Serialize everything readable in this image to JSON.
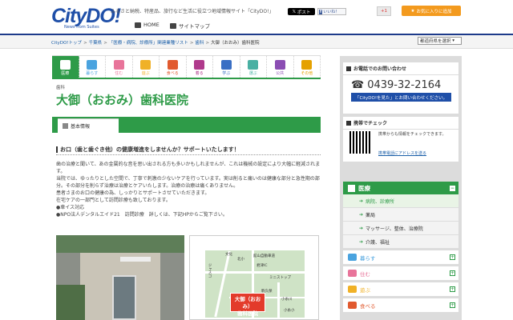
{
  "header": {
    "logo": "CityDO!",
    "logo_sub": "News from Suites",
    "tagline": "ふるさと納税、特産品、旅行など生活に役立つ地域情報サイト「CityDO!」",
    "nav_home": "HOME",
    "nav_sitemap": "サイトマップ",
    "x_button": "ポスト",
    "like_button": "いいね！",
    "gplus_button": "+1",
    "fav_button": "お気に入りに追加"
  },
  "breadcrumbs": [
    "CityDO!トップ",
    "千葉県",
    "「医療・病院、診療所」関連業種リスト",
    "歯科",
    "大御（おおみ）歯科医院"
  ],
  "prefecture_select": "都道府県を選択",
  "categories": [
    {
      "label": "医療",
      "color": "#2e9b48"
    },
    {
      "label": "暮らす",
      "color": "#4aa3df"
    },
    {
      "label": "住む",
      "color": "#e8749a"
    },
    {
      "label": "遊ぶ",
      "color": "#f0b127"
    },
    {
      "label": "食べる",
      "color": "#e15a2f"
    },
    {
      "label": "着る",
      "color": "#b03a8c"
    },
    {
      "label": "学ぶ",
      "color": "#3a6fc4"
    },
    {
      "label": "選ぶ",
      "color": "#49b0a3"
    },
    {
      "label": "公共",
      "color": "#8b4db3"
    },
    {
      "label": "その他",
      "color": "#e5a100"
    }
  ],
  "small_category": "歯科",
  "title": "大御（おおみ）歯科医院",
  "tab_basic": "基本情報",
  "section_heading": "お口（歯と歯ぐき他）の健康増進をしませんか？サポートいたします！",
  "body_lines": [
    "歯の治療と聞いて、あの金属的な音を思い出される方も多いかもしれませんが、これは機械の設定により大幅に軽減されます。",
    "当院では、ゆったりとした空間で、丁寧で刺激の少ないケアを行っています。実は削ると痛いのは健康な部分と急性期の部分。その部分を削らず治療は治療とケアいたします。治療の治療は痛くありません。",
    "患者さまのお口の健康の為、しっかりとサポートさせていただきます。",
    "在宅ケアの一部門として訪問診療も致しております。",
    "●車イス対応",
    "●NPO法人デンタルエイド21　訪問診療　詳しくは、下記HPからご覧下さい。"
  ],
  "map": {
    "labels": [
      "館山自動車道",
      "君津IC",
      "ミニストップ",
      "ジャスコ",
      "文化",
      "北小",
      "駒久保",
      "小糸川",
      "小糸小"
    ],
    "pin": [
      "大御（おおみ）",
      "歯科医院"
    ]
  },
  "sidebar": {
    "phone_heading": "お電話でのお問い合わせ",
    "phone": "0439-32-2164",
    "phone_button": "「CityDO!を見た」とお問い合わせください。",
    "mobile_heading": "携帯でチェック",
    "mobile_text": "携帯からも情報をチェックできます。",
    "mobile_link": "携帯電話にアドレスを送る",
    "menu_head": "医療",
    "sub_items": [
      "病院、診療所",
      "薬局",
      "マッサージ、整体、治療院",
      "介護、福祉"
    ],
    "more_categories": [
      {
        "label": "暮らす",
        "color": "#4aa3df"
      },
      {
        "label": "住む",
        "color": "#e8749a"
      },
      {
        "label": "遊ぶ",
        "color": "#f0b127"
      },
      {
        "label": "食べる",
        "color": "#e15a2f"
      }
    ]
  }
}
